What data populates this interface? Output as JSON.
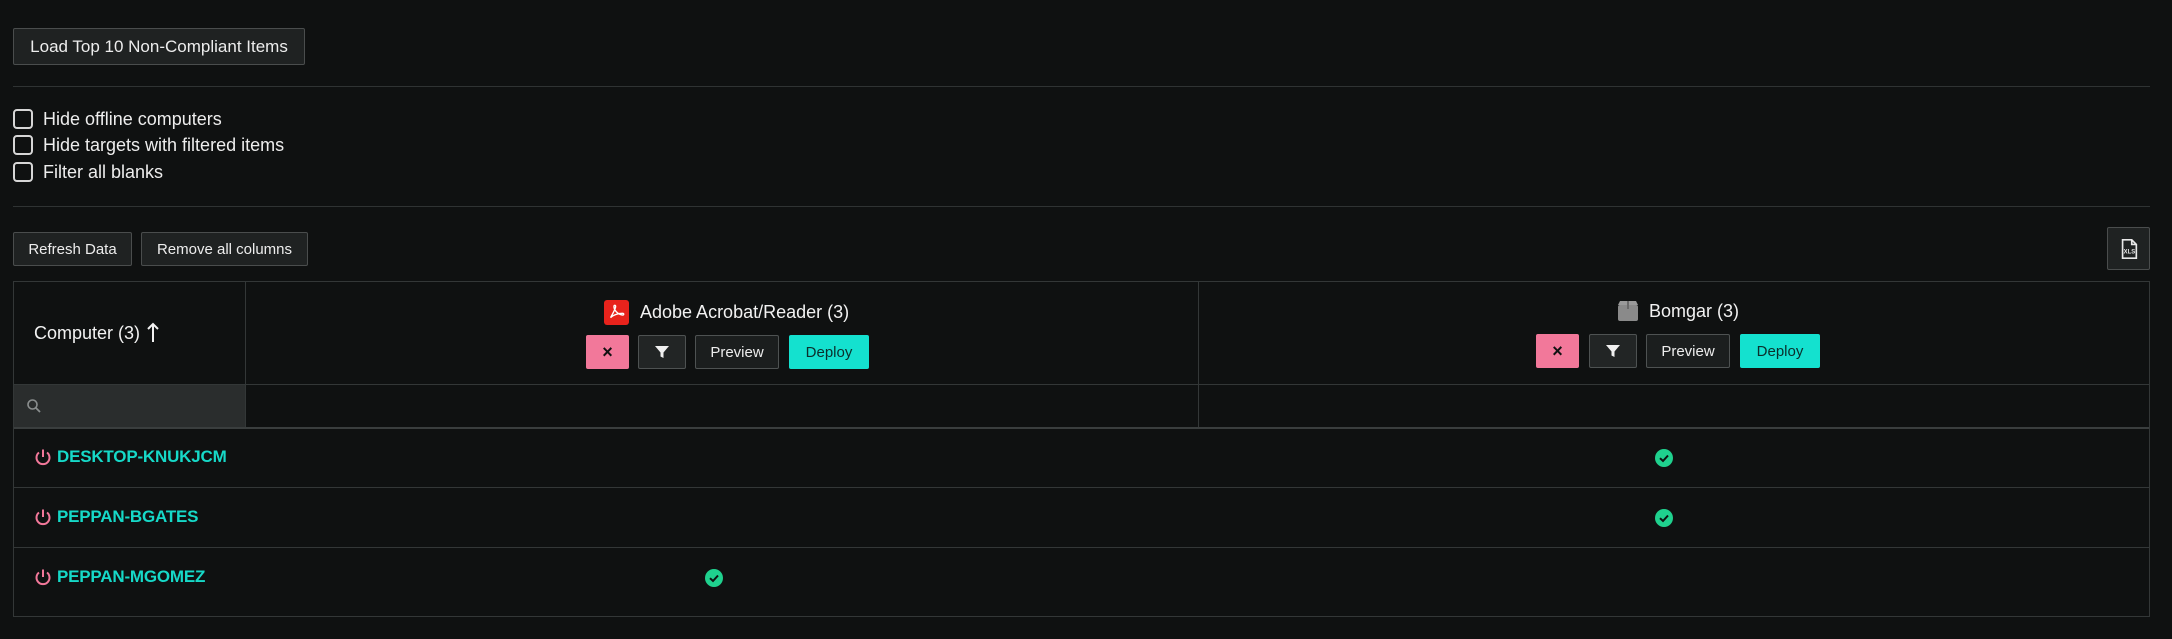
{
  "toolbar": {
    "load_top10_label": "Load Top 10 Non-Compliant Items",
    "refresh_label": "Refresh Data",
    "remove_columns_label": "Remove all columns"
  },
  "filters": [
    {
      "label": "Hide offline computers",
      "checked": false
    },
    {
      "label": "Hide targets with filtered items",
      "checked": false
    },
    {
      "label": "Filter all blanks",
      "checked": false
    }
  ],
  "table": {
    "computer_header": "Computer (3)",
    "sort_direction": "ascending",
    "search_placeholder": "",
    "columns": [
      {
        "title": "Adobe Acrobat/Reader (3)",
        "icon": "adobe-pdf-icon",
        "icon_color": "#e8231c",
        "remove_label": "×",
        "preview_label": "Preview",
        "deploy_label": "Deploy"
      },
      {
        "title": "Bomgar (3)",
        "icon": "package-icon",
        "icon_color": "#8a8a8a",
        "remove_label": "×",
        "preview_label": "Preview",
        "deploy_label": "Deploy"
      }
    ],
    "rows": [
      {
        "name": "DESKTOP-KNUKJCM",
        "status": "offline",
        "adobe": "",
        "bomgar": "compliant"
      },
      {
        "name": "PEPPAN-BGATES",
        "status": "offline",
        "adobe": "",
        "bomgar": "compliant"
      },
      {
        "name": "PEPPAN-MGOMEZ",
        "status": "offline",
        "adobe": "compliant",
        "bomgar": ""
      }
    ]
  },
  "colors": {
    "accent_teal": "#14e1cf",
    "remove_pink": "#f2789a",
    "power_icon": "#f2789a",
    "check_green": "#1fd18e",
    "background": "#0f1111"
  }
}
